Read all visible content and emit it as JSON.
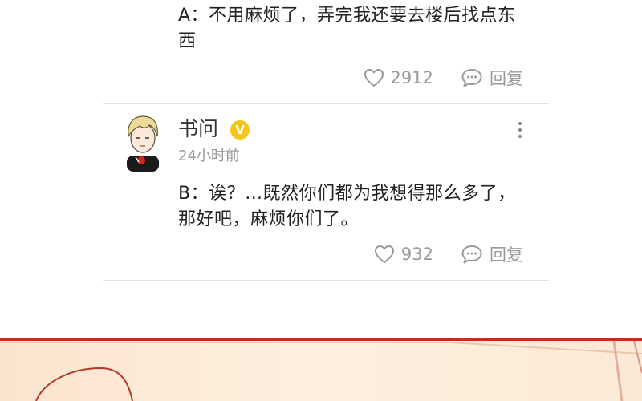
{
  "comment_1": {
    "text": "A：不用麻烦了，弄完我还要去楼后找点东西",
    "like_count": "2912",
    "reply_label": "回复"
  },
  "comment_2": {
    "username": "书问",
    "verified_badge": "V",
    "timestamp": "24小时前",
    "text": "B：诶？…既然你们都为我想得那么多了，那好吧，麻烦你们了。",
    "like_count": "932",
    "reply_label": "回复"
  },
  "icons": {
    "like": "heart-outline-icon",
    "reply": "speech-bubble-icon",
    "more": "vertical-ellipsis-icon"
  },
  "colors": {
    "verified_badge": "#f5c518",
    "meta_text": "#9a9a9a",
    "panel_border": "#c0301e"
  }
}
